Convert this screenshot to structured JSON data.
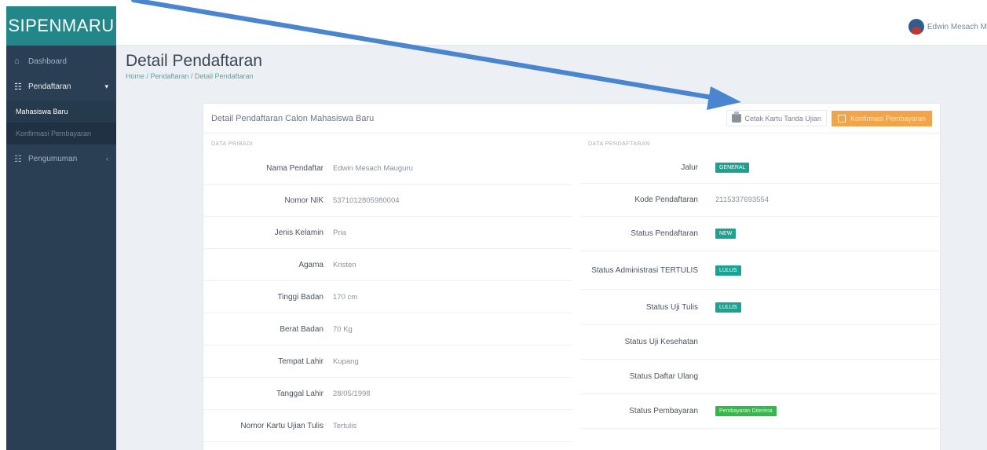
{
  "app": {
    "brand": "SIPENMARU"
  },
  "sidebar": {
    "items": [
      {
        "label": "Dashboard",
        "icon": "home-icon"
      },
      {
        "label": "Pendaftaran",
        "icon": "users-icon",
        "sub": [
          "Mahasiswa Baru",
          "Konfirmasi Pembayaran"
        ]
      },
      {
        "label": "Pengumuman",
        "icon": "users-icon"
      }
    ]
  },
  "topbar": {
    "user_name": "Edwin Mesach M"
  },
  "page": {
    "title": "Detail Pendaftaran",
    "breadcrumb": "Home / Pendaftaran / Detail Pendaftaran"
  },
  "card": {
    "title": "Detail Pendaftaran Calon Mahasiswa Baru",
    "print_label": "Cetak Kartu Tanda Ujian",
    "confirm_label": "Konfirmasi Pembayaran"
  },
  "personal": {
    "section": "DATA PRIBADI",
    "rows": [
      {
        "label": "Nama Pendaftar",
        "value": "Edwin Mesach Mauguru"
      },
      {
        "label": "Nomor NIK",
        "value": "5371012805980004"
      },
      {
        "label": "Jenis Kelamin",
        "value": "Pria"
      },
      {
        "label": "Agama",
        "value": "Kristen"
      },
      {
        "label": "Tinggi Badan",
        "value": "170 cm"
      },
      {
        "label": "Berat Badan",
        "value": "70 Kg"
      },
      {
        "label": "Tempat Lahir",
        "value": "Kupang"
      },
      {
        "label": "Tanggal Lahir",
        "value": "28/05/1998"
      },
      {
        "label": "Nomor Kartu Ujian Tulis",
        "value": "Tertulis"
      }
    ]
  },
  "registration": {
    "section": "DATA PENDAFTARAN",
    "rows": [
      {
        "label": "Jalur",
        "badge": "GENERAL",
        "badge_color": "#1aa392"
      },
      {
        "label": "Kode Pendaftaran",
        "value": "2115337693554"
      },
      {
        "label": "Status Pendaftaran",
        "badge": "NEW",
        "badge_color": "#1aa392"
      },
      {
        "label": "Status Administrasi TERTULIS",
        "badge": "LULUS",
        "badge_color": "#1aa392"
      },
      {
        "label": "Status Uji Tulis",
        "badge": "LULUS",
        "badge_color": "#1aa392"
      },
      {
        "label": "Status Uji Kesehatan"
      },
      {
        "label": "Status Daftar Ulang"
      },
      {
        "label": "Status Pembayaran",
        "badge": "Pembayaran Diterima",
        "badge_color": "#35b84b"
      }
    ]
  },
  "annotation": {
    "arrow_color": "#4a86cf"
  }
}
